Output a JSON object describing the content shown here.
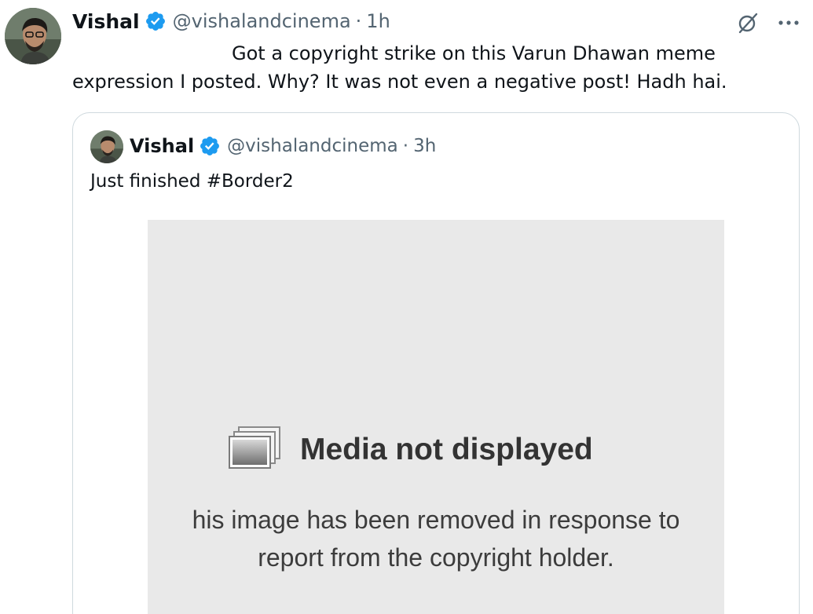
{
  "tweet": {
    "author_name": "Vishal",
    "handle": "@vishalandcinema",
    "separator": "·",
    "time": "1h",
    "text_line1": "Got a copyright strike on this Varun Dhawan meme",
    "text_line2": "expression I posted. Why? It was not even a negative post! Hadh hai."
  },
  "quoted_tweet": {
    "author_name": "Vishal",
    "handle": "@vishalandcinema",
    "separator": "·",
    "time": "3h",
    "text": "Just finished #Border2",
    "media": {
      "title": "Media not displayed",
      "message_line1": "his image has been removed in response to",
      "message_line2": "report from the copyright holder."
    }
  },
  "icons": {
    "verified": "verified-badge-icon",
    "grok": "grok-icon",
    "more": "more-options-icon"
  },
  "colors": {
    "verified_blue": "#1d9bf0",
    "secondary_text": "#536471",
    "border": "#cfd9de",
    "media_bg": "#e9e9e9"
  },
  "more_label": "···"
}
